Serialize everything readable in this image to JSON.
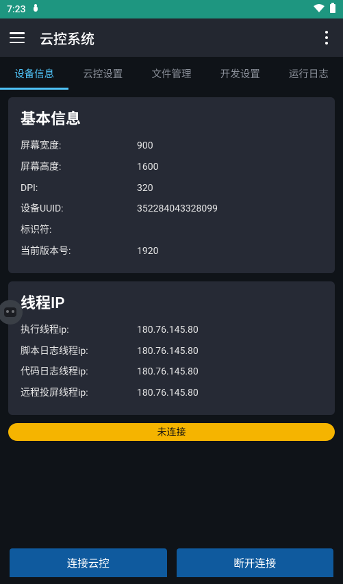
{
  "statusbar": {
    "time": "7:23"
  },
  "appbar": {
    "title": "云控系统"
  },
  "tabs": [
    {
      "label": "设备信息",
      "active": true
    },
    {
      "label": "云控设置",
      "active": false
    },
    {
      "label": "文件管理",
      "active": false
    },
    {
      "label": "开发设置",
      "active": false
    },
    {
      "label": "运行日志",
      "active": false
    }
  ],
  "basic_info": {
    "title": "基本信息",
    "rows": [
      {
        "label": "屏幕宽度:",
        "value": "900"
      },
      {
        "label": "屏幕高度:",
        "value": "1600"
      },
      {
        "label": "DPI:",
        "value": "320"
      },
      {
        "label": "设备UUID:",
        "value": "352284043328099"
      },
      {
        "label": "标识符:",
        "value": ""
      },
      {
        "label": "当前版本号:",
        "value": "1920"
      }
    ]
  },
  "thread_ip": {
    "title": "线程IP",
    "rows": [
      {
        "label": "执行线程ip:",
        "value": "180.76.145.80"
      },
      {
        "label": "脚本日志线程ip:",
        "value": "180.76.145.80"
      },
      {
        "label": "代码日志线程ip:",
        "value": "180.76.145.80"
      },
      {
        "label": "远程投屏线程ip:",
        "value": "180.76.145.80"
      }
    ]
  },
  "status": {
    "label": "未连接",
    "color": "#f5b400"
  },
  "buttons": {
    "connect": "连接云控",
    "disconnect": "断开连接"
  }
}
